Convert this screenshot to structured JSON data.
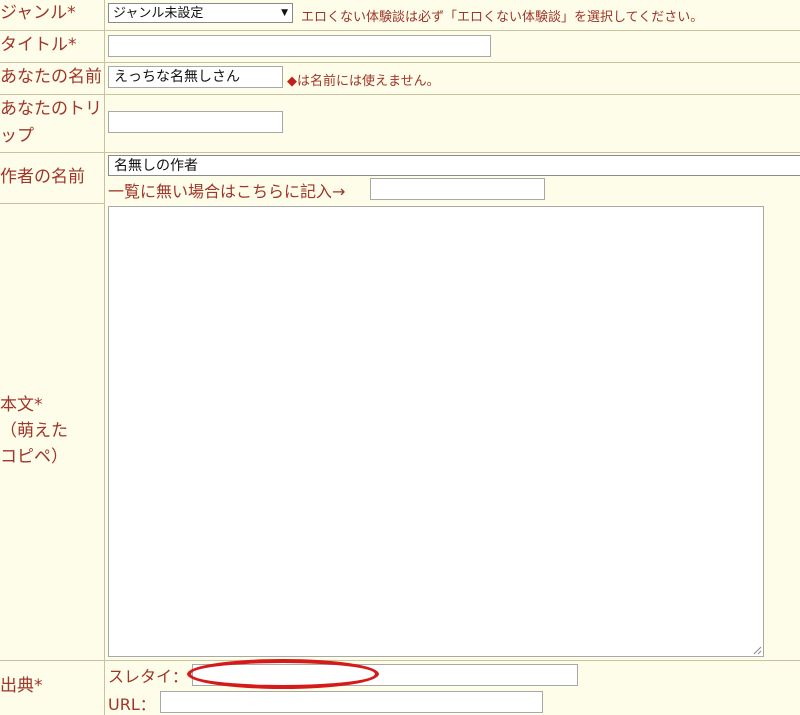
{
  "form": {
    "genre": {
      "label": "ジャンル*",
      "selected": "ジャンル未設定",
      "note": "エロくない体験談は必ず「エロくない体験談」を選択してください。"
    },
    "title": {
      "label": "タイトル*",
      "value": ""
    },
    "name": {
      "label": "あなたの名前",
      "value": "えっちな名無しさん",
      "note_marker": "◆",
      "note": "は名前には使えません。"
    },
    "trip": {
      "label_line1": "あなたのトリ",
      "label_line2": "ップ",
      "value": ""
    },
    "author": {
      "label": "作者の名前",
      "selected": "名無しの作者",
      "other_prompt": "一覧に無い場合はこちらに記入→",
      "other_value": ""
    },
    "body": {
      "label_line1": "本文*",
      "label_line2": "（萌えた",
      "label_line3": "コピペ）",
      "value": ""
    },
    "source": {
      "label": "出典*",
      "thread_title_label": "スレタイ：",
      "thread_title_value": "",
      "url_label": "URL：",
      "url_value": ""
    }
  },
  "annotation": {
    "color": "#d61a1a",
    "shape": "ellipse"
  }
}
